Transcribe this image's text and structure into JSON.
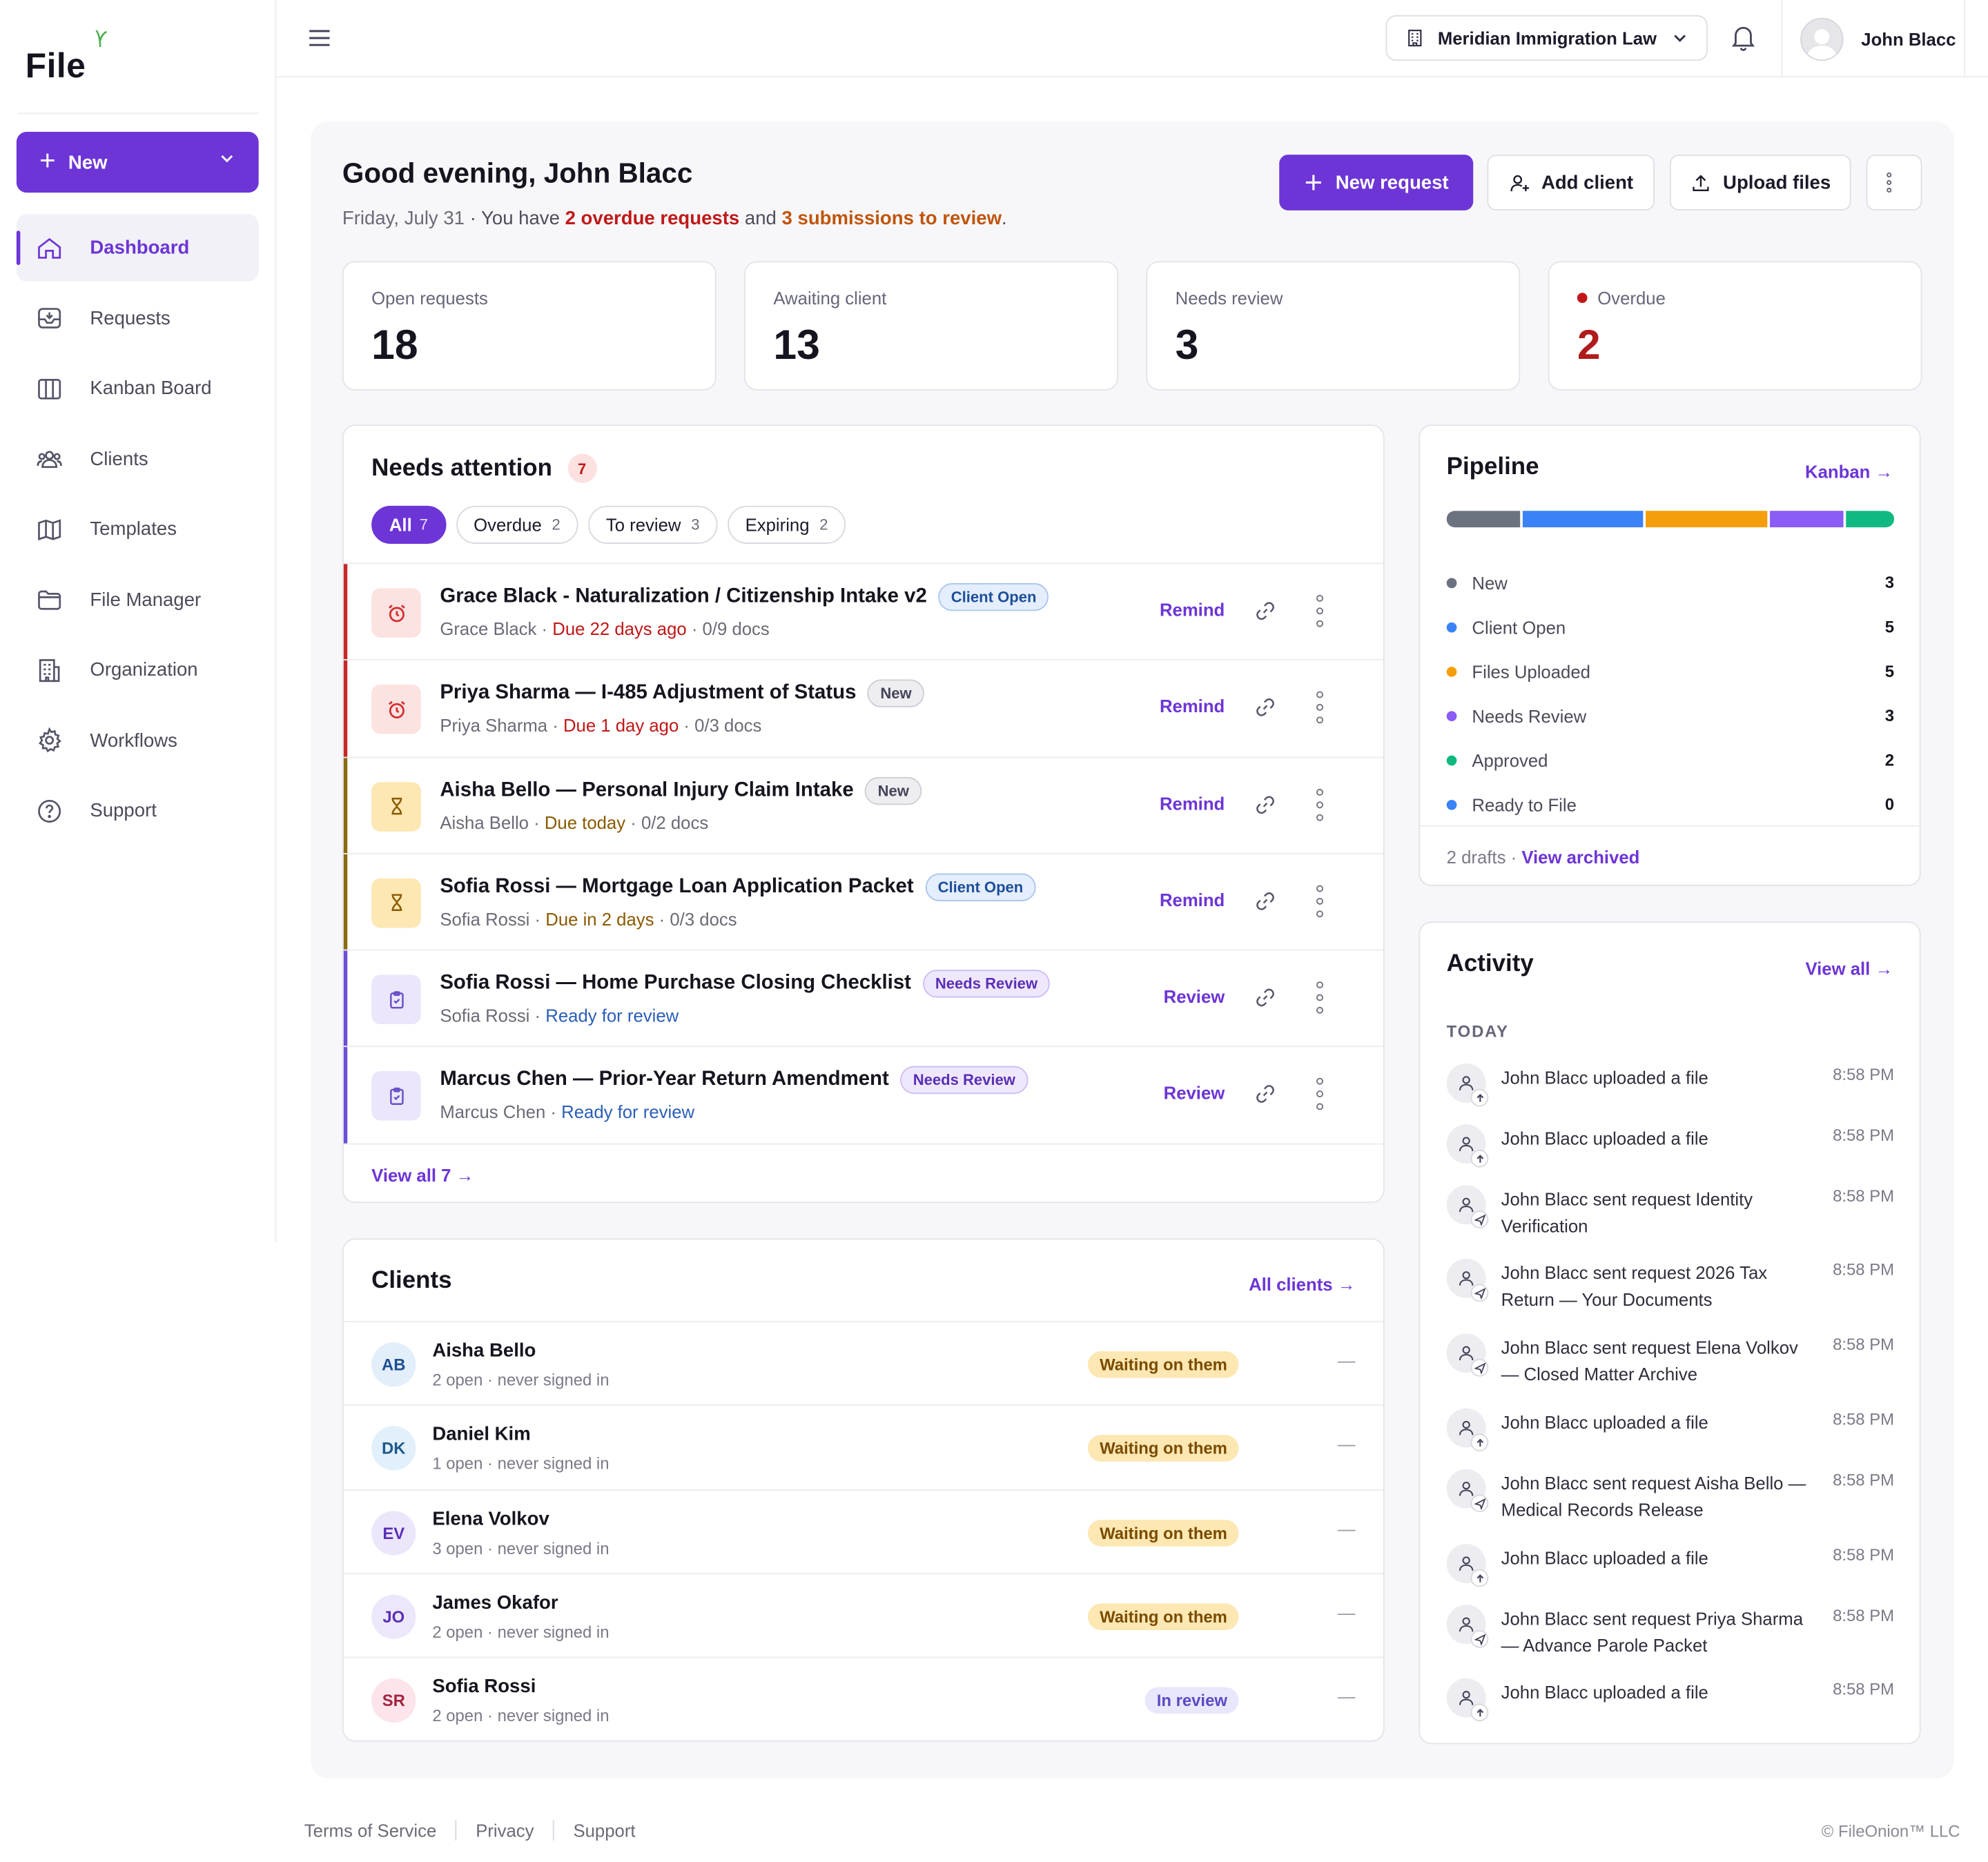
{
  "brand": {
    "logo_text": "File",
    "accent": "#6d35d6",
    "sprout_color": "#4caf50"
  },
  "sidebar": {
    "new_label": "New",
    "items": [
      {
        "label": "Dashboard",
        "icon": "home-icon",
        "active": true
      },
      {
        "label": "Requests",
        "icon": "inbox-icon"
      },
      {
        "label": "Kanban Board",
        "icon": "columns-icon"
      },
      {
        "label": "Clients",
        "icon": "users-icon"
      },
      {
        "label": "Templates",
        "icon": "map-icon"
      },
      {
        "label": "File Manager",
        "icon": "folder-icon"
      },
      {
        "label": "Organization",
        "icon": "building-icon"
      },
      {
        "label": "Workflows",
        "icon": "gear-icon"
      },
      {
        "label": "Support",
        "icon": "help-circle-icon"
      }
    ]
  },
  "topbar": {
    "org_name": "Meridian Immigration Law",
    "user_name": "John Blacc"
  },
  "header": {
    "greeting": "Good evening, John Blacc",
    "date": "Friday, July 31",
    "sub_mid": " · You have ",
    "overdue_text": "2 overdue requests",
    "and_text": " and ",
    "review_text": "3 submissions to review",
    "end_text": ".",
    "new_request_label": "New request",
    "add_client_label": "Add client",
    "upload_files_label": "Upload files"
  },
  "stats": [
    {
      "label": "Open requests",
      "value": "18"
    },
    {
      "label": "Awaiting client",
      "value": "13"
    },
    {
      "label": "Needs review",
      "value": "3"
    },
    {
      "label": "Overdue",
      "value": "2",
      "color": "#b01b1b"
    }
  ],
  "attention": {
    "title": "Needs attention",
    "count": "7",
    "filters": [
      {
        "label": "All",
        "count": "7",
        "active": true
      },
      {
        "label": "Overdue",
        "count": "2"
      },
      {
        "label": "To review",
        "count": "3"
      },
      {
        "label": "Expiring",
        "count": "2"
      }
    ],
    "items": [
      {
        "title": "Grace Black - Naturalization / Citizenship Intake v2",
        "status": "Client Open",
        "client": "Grace Black",
        "due": "Due 22 days ago",
        "docs": "0/9 docs",
        "action": "Remind",
        "kind": "overdue"
      },
      {
        "title": "Priya Sharma — I-485 Adjustment of Status",
        "status": "New",
        "client": "Priya Sharma",
        "due": "Due 1 day ago",
        "docs": "0/3 docs",
        "action": "Remind",
        "kind": "overdue"
      },
      {
        "title": "Aisha Bello — Personal Injury Claim Intake",
        "status": "New",
        "client": "Aisha Bello",
        "due": "Due today",
        "docs": "0/2 docs",
        "action": "Remind",
        "kind": "expiring"
      },
      {
        "title": "Sofia Rossi — Mortgage Loan Application Packet",
        "status": "Client Open",
        "client": "Sofia Rossi",
        "due": "Due in 2 days",
        "docs": "0/3 docs",
        "action": "Remind",
        "kind": "expiring"
      },
      {
        "title": "Sofia Rossi — Home Purchase Closing Checklist",
        "status": "Needs Review",
        "client": "Sofia Rossi",
        "due": "Ready for review",
        "docs": "",
        "action": "Review",
        "kind": "review"
      },
      {
        "title": "Marcus Chen — Prior-Year Return Amendment",
        "status": "Needs Review",
        "client": "Marcus Chen",
        "due": "Ready for review",
        "docs": "",
        "action": "Review",
        "kind": "review"
      }
    ],
    "view_all": "View all 7 →"
  },
  "clients": {
    "title": "Clients",
    "link": "All clients →",
    "rows": [
      {
        "initials": "AB",
        "name": "Aisha Bello",
        "sub": "2 open · never signed in",
        "status": "Waiting on them",
        "dash": "—"
      },
      {
        "initials": "DK",
        "name": "Daniel Kim",
        "sub": "1 open · never signed in",
        "status": "Waiting on them",
        "dash": "—"
      },
      {
        "initials": "EV",
        "name": "Elena Volkov",
        "sub": "3 open · never signed in",
        "status": "Waiting on them",
        "dash": "—"
      },
      {
        "initials": "JO",
        "name": "James Okafor",
        "sub": "2 open · never signed in",
        "status": "Waiting on them",
        "dash": "—"
      },
      {
        "initials": "SR",
        "name": "Sofia Rossi",
        "sub": "2 open · never signed in",
        "status": "In review",
        "dash": "—"
      }
    ]
  },
  "pipeline": {
    "title": "Pipeline",
    "link": "Kanban →",
    "stages": [
      {
        "name": "New",
        "value": 3,
        "color": "#6b7280"
      },
      {
        "name": "Client Open",
        "value": 5,
        "color": "#3b82f6"
      },
      {
        "name": "Files Uploaded",
        "value": 5,
        "color": "#f59e0b"
      },
      {
        "name": "Needs Review",
        "value": 3,
        "color": "#8b5cf6"
      },
      {
        "name": "Approved",
        "value": 2,
        "color": "#10b981"
      },
      {
        "name": "Ready to File",
        "value": 0,
        "color": "#3b82f6"
      }
    ],
    "drafts": "2 drafts",
    "view_archived": "View archived"
  },
  "activity": {
    "title": "Activity",
    "link": "View all →",
    "section": "TODAY",
    "items": [
      {
        "text": "John Blacc uploaded a file",
        "time": "8:58 PM",
        "type": "upload"
      },
      {
        "text": "John Blacc uploaded a file",
        "time": "8:58 PM",
        "type": "upload"
      },
      {
        "text": "John Blacc sent request Identity Verification",
        "time": "8:58 PM",
        "type": "send"
      },
      {
        "text": "John Blacc sent request 2026 Tax Return — Your Documents",
        "time": "8:58 PM",
        "type": "send"
      },
      {
        "text": "John Blacc sent request Elena Volkov — Closed Matter Archive",
        "time": "8:58 PM",
        "type": "send"
      },
      {
        "text": "John Blacc uploaded a file",
        "time": "8:58 PM",
        "type": "upload"
      },
      {
        "text": "John Blacc sent request Aisha Bello — Medical Records Release",
        "time": "8:58 PM",
        "type": "send"
      },
      {
        "text": "John Blacc uploaded a file",
        "time": "8:58 PM",
        "type": "upload"
      },
      {
        "text": "John Blacc sent request Priya Sharma — Advance Parole Packet",
        "time": "8:58 PM",
        "type": "send"
      },
      {
        "text": "John Blacc uploaded a file",
        "time": "8:58 PM",
        "type": "upload"
      }
    ]
  },
  "footer": {
    "links": [
      "Terms of Service",
      "Privacy",
      "Support"
    ],
    "copyright": "© FileOnion™ LLC"
  }
}
